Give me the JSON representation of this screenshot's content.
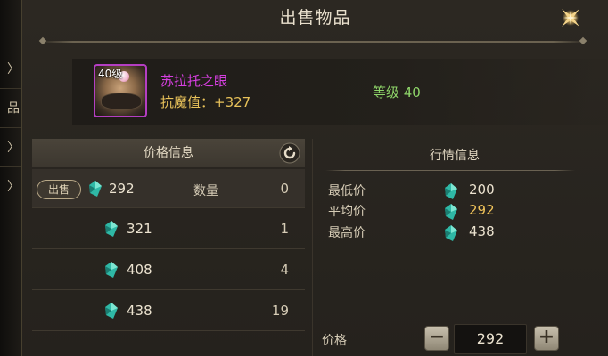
{
  "bg_strip": {
    "items": [
      "〉",
      "品",
      "〉",
      "〉"
    ]
  },
  "dialog": {
    "title": "出售物品"
  },
  "item": {
    "level_badge": "40级",
    "name": "苏拉托之眼",
    "attr_label": "抗魔值：",
    "attr_value": "+327",
    "level_text": "等级 40",
    "name_color": "#d63fe0",
    "border_color": "#b43ec2"
  },
  "price_info": {
    "header": "价格信息",
    "sell_label": "出售",
    "quantity_label": "数量",
    "rows": [
      {
        "price": "292",
        "qty": "0"
      },
      {
        "price": "321",
        "qty": "1"
      },
      {
        "price": "408",
        "qty": "4"
      },
      {
        "price": "438",
        "qty": "19"
      }
    ]
  },
  "market_info": {
    "header": "行情信息",
    "rows": [
      {
        "label": "最低价",
        "value": "200"
      },
      {
        "label": "平均价",
        "value": "292"
      },
      {
        "label": "最高价",
        "value": "438"
      }
    ]
  },
  "price_input": {
    "label": "价格",
    "value": "292",
    "minus": "−",
    "plus": "+"
  },
  "icons": {
    "close": "close-star-icon",
    "refresh": "refresh-icon",
    "currency": "crystal-gem-icon"
  }
}
